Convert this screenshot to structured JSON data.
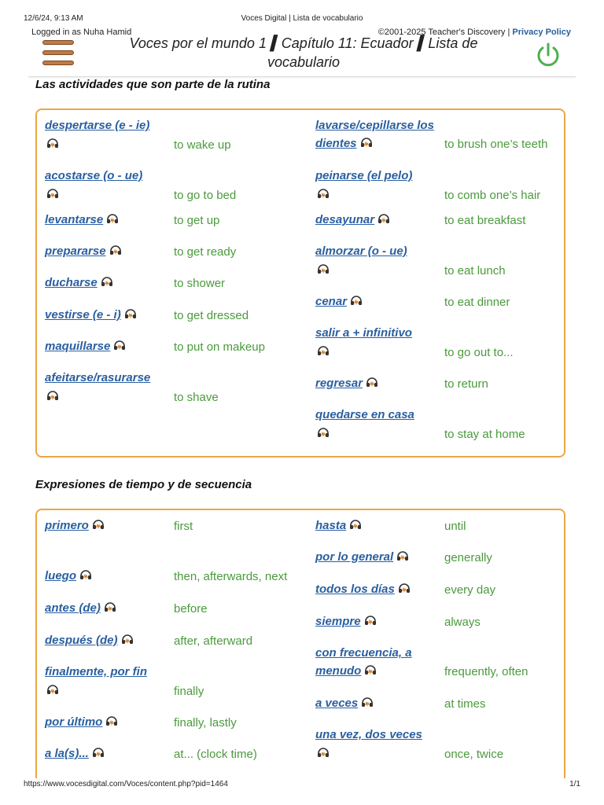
{
  "print": {
    "datetime": "12/6/24, 9:13 AM",
    "title": "Voces Digital | Lista de vocabulario",
    "url": "https://www.vocesdigital.com/Voces/content.php?pid=1464",
    "page": "1/1"
  },
  "header": {
    "logged_in": "Logged in as Nuha Hamid",
    "copyright": "©2001-2025 Teacher's Discovery | ",
    "privacy": "Privacy Policy",
    "title": "Voces por el mundo 1 ▍Capítulo 11: Ecuador ▍Lista de vocabulario",
    "menu_icon": "hamburger-menu-icon",
    "power_icon": "power-icon",
    "accent_color": "#c07a44",
    "power_color": "#4caf50"
  },
  "sections": [
    {
      "title": "Las actividades que son parte de la rutina",
      "left": [
        {
          "term": "despertarse (e - ie)",
          "def": "to wake up"
        },
        {
          "term": "acostarse (o - ue)",
          "def": "to go to bed"
        },
        {
          "term": "levantarse",
          "def": "to get up"
        },
        {
          "term": "prepararse",
          "def": "to get ready"
        },
        {
          "term": "ducharse",
          "def": "to shower"
        },
        {
          "term": "vestirse (e - i)",
          "def": "to get dressed"
        },
        {
          "term": "maquillarse",
          "def": "to put on makeup"
        },
        {
          "term": "afeitarse/rasurarse",
          "def": "to shave"
        }
      ],
      "right": [
        {
          "term": "lavarse/cepillarse los dientes",
          "def": "to brush one’s teeth"
        },
        {
          "term": "peinarse (el pelo)",
          "def": "to comb one’s hair"
        },
        {
          "term": "desayunar",
          "def": "to eat breakfast"
        },
        {
          "term": "almorzar (o - ue)",
          "def": "to eat lunch"
        },
        {
          "term": "cenar",
          "def": "to eat dinner"
        },
        {
          "term": "salir a + infinitivo",
          "def": "to go out to..."
        },
        {
          "term": "regresar",
          "def": "to return"
        },
        {
          "term": "quedarse en casa",
          "def": "to stay at home"
        }
      ]
    },
    {
      "title": "Expresiones de tiempo y de secuencia",
      "left": [
        {
          "term": "primero",
          "def": "first"
        },
        {
          "term": "luego",
          "def": "then, afterwards, next"
        },
        {
          "term": "antes (de)",
          "def": "before"
        },
        {
          "term": "después (de)",
          "def": "after, afterward"
        },
        {
          "term": "finalmente, por fin",
          "def": "finally"
        },
        {
          "term": "por último",
          "def": "finally, lastly"
        },
        {
          "term": "a la(s)...",
          "def": "at... (clock time)"
        }
      ],
      "right": [
        {
          "term": "hasta",
          "def": "until"
        },
        {
          "term": "por lo general",
          "def": "generally"
        },
        {
          "term": "todos los días",
          "def": "every day"
        },
        {
          "term": "siempre",
          "def": "always"
        },
        {
          "term": "con frecuencia, a menudo",
          "def": "frequently, often"
        },
        {
          "term": "a veces",
          "def": "at times"
        },
        {
          "term": "una vez, dos veces",
          "def": "once, twice"
        }
      ]
    }
  ],
  "audio_icon": "headphones-audio-icon",
  "colors": {
    "term": "#2a5fa0",
    "definition": "#4a9a3c",
    "box_border": "#eba744"
  }
}
